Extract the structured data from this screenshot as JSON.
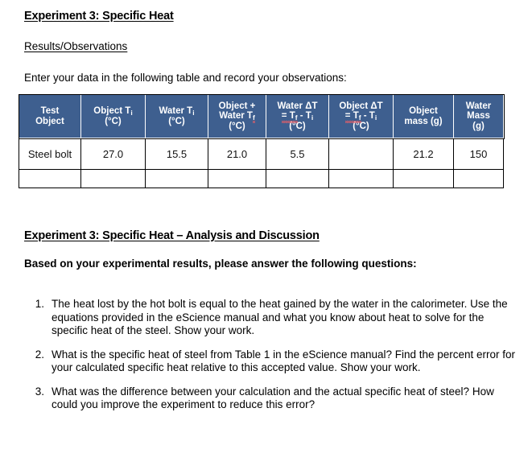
{
  "document": {
    "heading_1": "Experiment 3: Specific Heat",
    "subheading_results": "Results/Observations",
    "instruction": "Enter your data in the following table and record your observations:",
    "heading_2": "Experiment 3: Specific Heat – Analysis and Discussion",
    "prompt": "Based on your experimental results, please answer the following questions:"
  },
  "table": {
    "header_color": "#3E5F8F",
    "columns": [
      {
        "line1": "Test",
        "line2": "Object",
        "line3": ""
      },
      {
        "line1": "Object T",
        "sub1": "i",
        "line2": "(°C)",
        "line3": ""
      },
      {
        "line1": "Water T",
        "sub1": "i",
        "line2": "(°C)",
        "line3": ""
      },
      {
        "line1": "Object +",
        "line2": "Water T",
        "sub2": "f",
        "line3": "(°C)"
      },
      {
        "line1": "Water ΔT",
        "line2": "= T",
        "sub2": "f",
        "line2b": " - T",
        "sub2b": "i",
        "line3": "(°C)"
      },
      {
        "line1": "Object ΔT",
        "line2": "= T",
        "sub2": "f",
        "line2b": " - T",
        "sub2b": "i",
        "line3": "(°C)"
      },
      {
        "line1": "Object",
        "line2": "mass (g)",
        "line3": ""
      },
      {
        "line1": "Water",
        "line2": "Mass",
        "line3": "(g)"
      }
    ],
    "rows": [
      {
        "test_object": "Steel bolt",
        "object_ti": "27.0",
        "water_ti": "15.5",
        "object_water_tf": "21.0",
        "water_delta_t": "5.5",
        "object_delta_t": "",
        "object_mass": "21.2",
        "water_mass": "150"
      },
      {
        "test_object": "",
        "object_ti": "",
        "water_ti": "",
        "object_water_tf": "",
        "water_delta_t": "",
        "object_delta_t": "",
        "object_mass": "",
        "water_mass": ""
      }
    ]
  },
  "questions": [
    {
      "number": "1.",
      "text": "The heat lost by the hot bolt is equal to the heat gained by the water in the calorimeter. Use the equations provided in the eScience manual and what you know about heat to solve for the specific heat of the steel. Show your work."
    },
    {
      "number": "2.",
      "text": "What is the specific heat of steel from Table 1 in the eScience manual?  Find the percent error for your calculated specific heat relative to this accepted value. Show your work."
    },
    {
      "number": "3.",
      "text": "What was the difference between your calculation and the actual specific heat of steel? How could you improve the experiment to reduce this error?"
    }
  ]
}
